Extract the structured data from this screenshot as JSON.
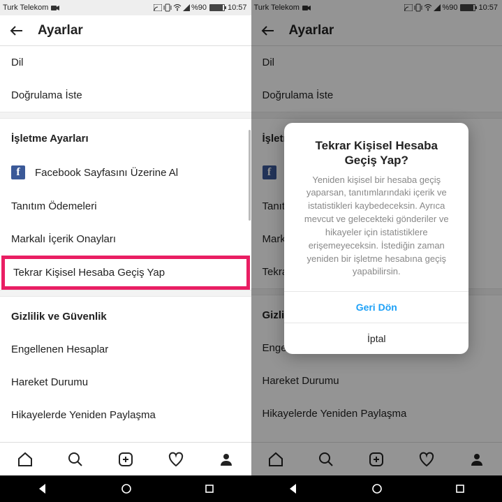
{
  "status": {
    "carrier": "Turk Telekom",
    "battery_pct": "%90",
    "time": "10:57"
  },
  "header": {
    "title": "Ayarlar"
  },
  "rows": {
    "dil": "Dil",
    "dogrulama": "Doğrulama İste",
    "isletme_heading": "İşletme Ayarları",
    "facebook": "Facebook Sayfasını Üzerine Al",
    "tanitim": "Tanıtım Ödemeleri",
    "markali": "Markalı İçerik Onayları",
    "gecis": "Tekrar Kişisel Hesaba Geçiş Yap",
    "gizlilik_heading": "Gizlilik ve Güvenlik",
    "engellenen": "Engellenen Hesaplar",
    "hareket": "Hareket Durumu",
    "hikayelerde": "Hikayelerde Yeniden Paylaşma"
  },
  "dialog": {
    "title": "Tekrar Kişisel Hesaba Geçiş Yap?",
    "body": "Yeniden kişisel bir hesaba geçiş yaparsan, tanıtımlarındaki içerik ve istatistikleri kaybedeceksin. Ayrıca mevcut ve gelecekteki gönderiler ve hikayeler için istatistiklere erişemeyeceksin. İstediğin zaman yeniden bir işletme hesabına geçiş yapabilirsin.",
    "primary": "Geri Dön",
    "secondary": "İptal"
  }
}
